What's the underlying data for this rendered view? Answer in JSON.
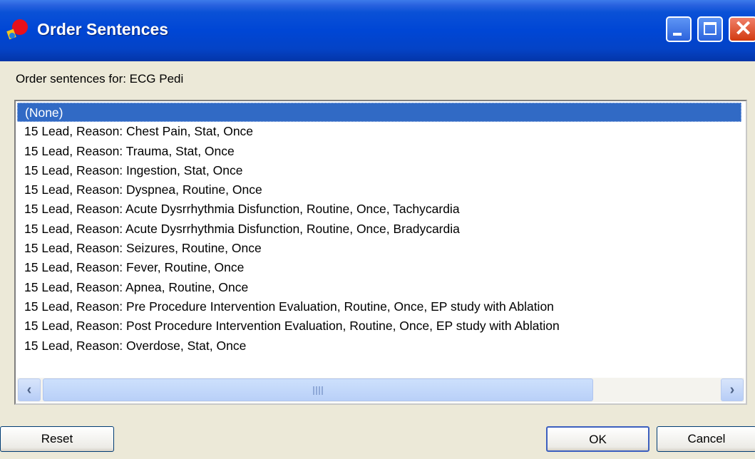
{
  "window": {
    "title": "Order Sentences"
  },
  "prompt": "Order sentences for:  ECG Pedi",
  "list": {
    "items": [
      "(None)",
      "15 Lead, Reason: Chest Pain, Stat, Once",
      "15 Lead, Reason: Trauma, Stat, Once",
      "15 Lead, Reason: Ingestion, Stat, Once",
      "15 Lead, Reason: Dyspnea, Routine, Once",
      "15 Lead, Reason: Acute Dysrrhythmia Disfunction, Routine, Once, Tachycardia",
      "15 Lead, Reason: Acute Dysrrhythmia Disfunction, Routine, Once, Bradycardia",
      "15 Lead, Reason: Seizures, Routine, Once",
      "15 Lead, Reason: Fever, Routine, Once",
      "15 Lead, Reason: Apnea, Routine, Once",
      "15 Lead, Reason: Pre Procedure Intervention Evaluation, Routine, Once, EP study with Ablation",
      "15 Lead, Reason: Post Procedure Intervention Evaluation, Routine, Once, EP study with Ablation",
      "15 Lead, Reason: Overdose, Stat, Once"
    ],
    "selected_index": 0
  },
  "buttons": {
    "reset": "Reset",
    "ok": "OK",
    "cancel": "Cancel"
  },
  "icons": {
    "app": "order-app-icon",
    "minimize": "minimize-icon",
    "maximize": "maximize-icon",
    "close": "close-icon",
    "scroll_left": "chevron-left-icon",
    "scroll_right": "chevron-right-icon"
  },
  "colors": {
    "titlebar": "#0a51d6",
    "selection": "#316ac5",
    "dialog_bg": "#ece9d8",
    "close_button": "#d23a10"
  }
}
